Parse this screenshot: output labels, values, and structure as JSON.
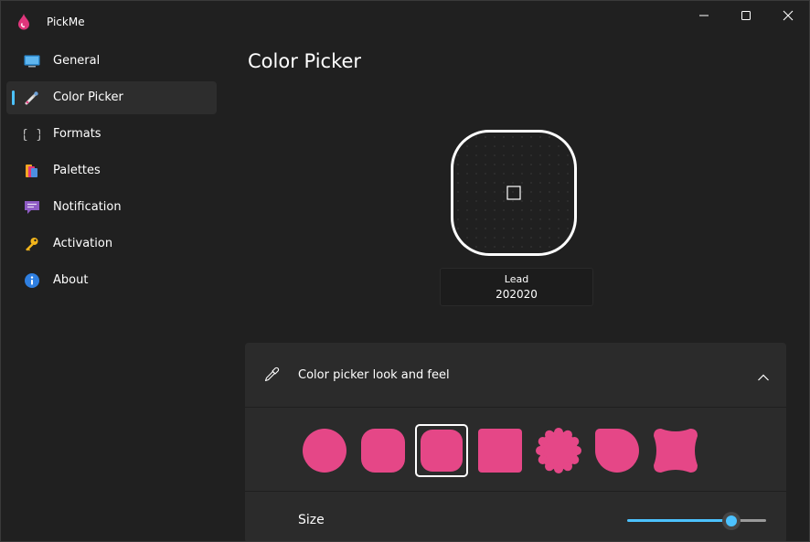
{
  "app": {
    "title": "PickMe"
  },
  "sidebar": {
    "items": [
      {
        "label": "General",
        "icon": "monitor-icon",
        "selected": false
      },
      {
        "label": "Color Picker",
        "icon": "eyedropper-icon",
        "selected": true
      },
      {
        "label": "Formats",
        "icon": "braces-icon",
        "selected": false
      },
      {
        "label": "Palettes",
        "icon": "palette-icon",
        "selected": false
      },
      {
        "label": "Notification",
        "icon": "message-icon",
        "selected": false
      },
      {
        "label": "Activation",
        "icon": "key-icon",
        "selected": false
      },
      {
        "label": "About",
        "icon": "info-icon",
        "selected": false
      }
    ]
  },
  "main": {
    "title": "Color Picker",
    "preview": {
      "color_name": "Lead",
      "hex": "202020"
    },
    "look_and_feel": {
      "title": "Color picker look and feel",
      "expanded": true,
      "shapes": [
        "circle",
        "squircle",
        "rounded-square",
        "square",
        "scalloped",
        "rounded-teardrop",
        "pinched-square"
      ],
      "selected_shape": "rounded-square",
      "shape_color": "#e54787",
      "size_label": "Size",
      "size_value": 0.74
    }
  },
  "colors": {
    "accent": "#4cc2ff",
    "background": "#202020",
    "card": "#2b2b2b",
    "shape": "#e54787"
  }
}
